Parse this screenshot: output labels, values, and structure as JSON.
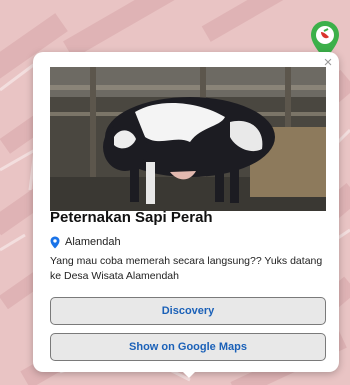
{
  "map": {
    "background_color": "#e9c4c4",
    "marker_icon": "map-pin-icon",
    "marker_color": "#3cb04a"
  },
  "popup": {
    "close_label": "×",
    "image_subject": "holstein-dairy-cow-photo",
    "title": "Peternakan Sapi Perah",
    "location_icon": "location-pin-icon",
    "location_icon_color": "#1a73e8",
    "location": "Alamendah",
    "description": "Yang mau coba memerah secara langsung?? Yuks datang ke Desa Wisata Alamendah",
    "buttons": {
      "discovery": "Discovery",
      "google_maps": "Show on Google Maps"
    },
    "button_text_color": "#1b61b8"
  }
}
